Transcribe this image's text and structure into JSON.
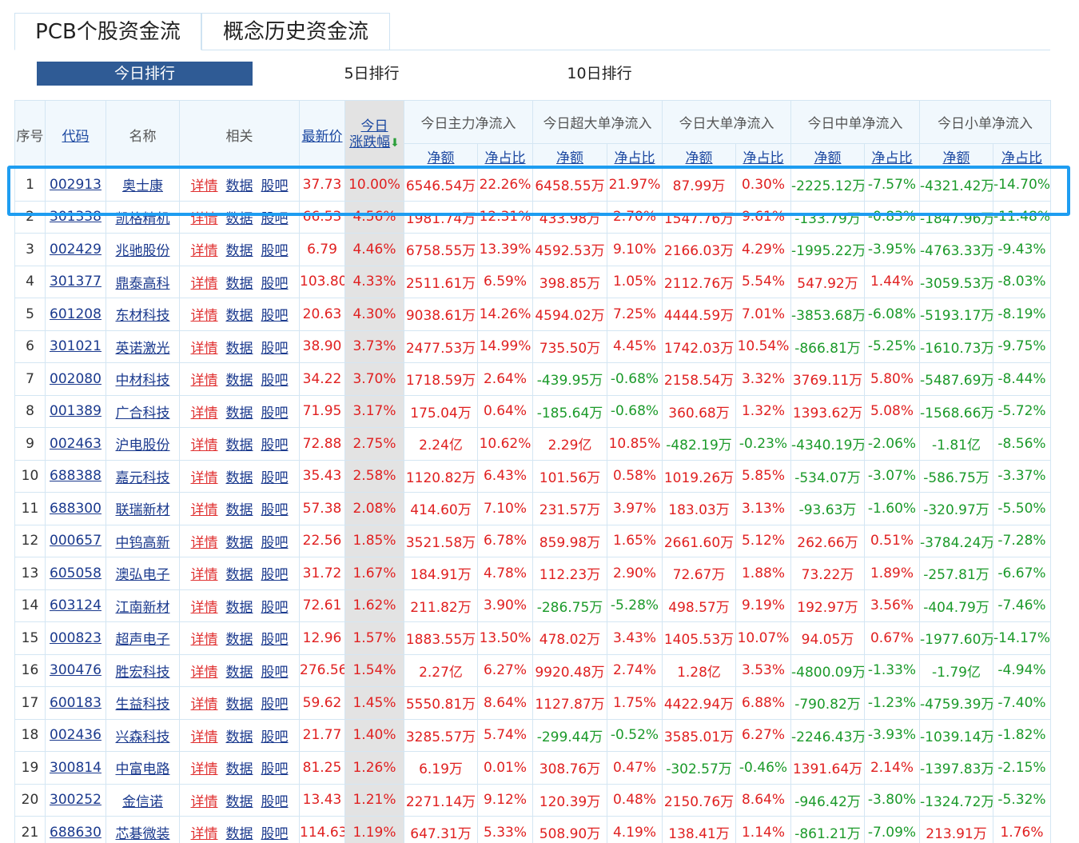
{
  "tabs": [
    {
      "label": "PCB个股资金流",
      "active": true
    },
    {
      "label": "概念历史资金流",
      "active": false
    }
  ],
  "subtabs": [
    {
      "label": "今日排行",
      "active": true
    },
    {
      "label": "5日排行",
      "active": false
    },
    {
      "label": "10日排行",
      "active": false
    }
  ],
  "header": {
    "seq": "序号",
    "code": "代码",
    "name": "名称",
    "related": "相关",
    "price": "最新价",
    "change_line1": "今日",
    "change_line2": "涨跌幅",
    "groups": [
      "今日主力净流入",
      "今日超大单净流入",
      "今日大单净流入",
      "今日中单净流入",
      "今日小单净流入"
    ],
    "net_amount": "净额",
    "net_ratio": "净占比"
  },
  "related_links": [
    "详情",
    "数据",
    "股吧"
  ],
  "colors": {
    "accent": "#2f5b95",
    "up": "#e02020",
    "down": "#1b9a2a",
    "highlight": "#1e9df1"
  },
  "rows": [
    [
      "1",
      "002913",
      "奥士康",
      "37.73",
      "10.00%",
      "6546.54万",
      "22.26%",
      "6458.55万",
      "21.97%",
      "87.99万",
      "0.30%",
      "-2225.12万",
      "-7.57%",
      "-4321.42万",
      "-14.70%"
    ],
    [
      "2",
      "301338",
      "凯格精机",
      "66.53",
      "4.56%",
      "1981.74万",
      "12.31%",
      "433.98万",
      "2.70%",
      "1547.76万",
      "9.61%",
      "-133.79万",
      "-0.83%",
      "-1847.96万",
      "-11.48%"
    ],
    [
      "3",
      "002429",
      "兆驰股份",
      "6.79",
      "4.46%",
      "6758.55万",
      "13.39%",
      "4592.53万",
      "9.10%",
      "2166.03万",
      "4.29%",
      "-1995.22万",
      "-3.95%",
      "-4763.33万",
      "-9.43%"
    ],
    [
      "4",
      "301377",
      "鼎泰高科",
      "103.80",
      "4.33%",
      "2511.61万",
      "6.59%",
      "398.85万",
      "1.05%",
      "2112.76万",
      "5.54%",
      "547.92万",
      "1.44%",
      "-3059.53万",
      "-8.03%"
    ],
    [
      "5",
      "601208",
      "东材科技",
      "20.63",
      "4.30%",
      "9038.61万",
      "14.26%",
      "4594.02万",
      "7.25%",
      "4444.59万",
      "7.01%",
      "-3853.68万",
      "-6.08%",
      "-5193.17万",
      "-8.19%"
    ],
    [
      "6",
      "301021",
      "英诺激光",
      "38.90",
      "3.73%",
      "2477.53万",
      "14.99%",
      "735.50万",
      "4.45%",
      "1742.03万",
      "10.54%",
      "-866.81万",
      "-5.25%",
      "-1610.73万",
      "-9.75%"
    ],
    [
      "7",
      "002080",
      "中材科技",
      "34.22",
      "3.70%",
      "1718.59万",
      "2.64%",
      "-439.95万",
      "-0.68%",
      "2158.54万",
      "3.32%",
      "3769.11万",
      "5.80%",
      "-5487.69万",
      "-8.44%"
    ],
    [
      "8",
      "001389",
      "广合科技",
      "71.95",
      "3.17%",
      "175.04万",
      "0.64%",
      "-185.64万",
      "-0.68%",
      "360.68万",
      "1.32%",
      "1393.62万",
      "5.08%",
      "-1568.66万",
      "-5.72%"
    ],
    [
      "9",
      "002463",
      "沪电股份",
      "72.88",
      "2.75%",
      "2.24亿",
      "10.62%",
      "2.29亿",
      "10.85%",
      "-482.19万",
      "-0.23%",
      "-4340.19万",
      "-2.06%",
      "-1.81亿",
      "-8.56%"
    ],
    [
      "10",
      "688388",
      "嘉元科技",
      "35.43",
      "2.58%",
      "1120.82万",
      "6.43%",
      "101.56万",
      "0.58%",
      "1019.26万",
      "5.85%",
      "-534.07万",
      "-3.07%",
      "-586.75万",
      "-3.37%"
    ],
    [
      "11",
      "688300",
      "联瑞新材",
      "57.38",
      "2.08%",
      "414.60万",
      "7.10%",
      "231.57万",
      "3.97%",
      "183.03万",
      "3.13%",
      "-93.63万",
      "-1.60%",
      "-320.97万",
      "-5.50%"
    ],
    [
      "12",
      "000657",
      "中钨高新",
      "22.56",
      "1.85%",
      "3521.58万",
      "6.78%",
      "859.98万",
      "1.65%",
      "2661.60万",
      "5.12%",
      "262.66万",
      "0.51%",
      "-3784.24万",
      "-7.28%"
    ],
    [
      "13",
      "605058",
      "澳弘电子",
      "31.72",
      "1.67%",
      "184.91万",
      "4.78%",
      "112.23万",
      "2.90%",
      "72.67万",
      "1.88%",
      "73.22万",
      "1.89%",
      "-257.81万",
      "-6.67%"
    ],
    [
      "14",
      "603124",
      "江南新材",
      "72.61",
      "1.62%",
      "211.82万",
      "3.90%",
      "-286.75万",
      "-5.28%",
      "498.57万",
      "9.19%",
      "192.97万",
      "3.56%",
      "-404.79万",
      "-7.46%"
    ],
    [
      "15",
      "000823",
      "超声电子",
      "12.96",
      "1.57%",
      "1883.55万",
      "13.50%",
      "478.02万",
      "3.43%",
      "1405.53万",
      "10.07%",
      "94.05万",
      "0.67%",
      "-1977.60万",
      "-14.17%"
    ],
    [
      "16",
      "300476",
      "胜宏科技",
      "276.56",
      "1.54%",
      "2.27亿",
      "6.27%",
      "9920.48万",
      "2.74%",
      "1.28亿",
      "3.53%",
      "-4800.09万",
      "-1.33%",
      "-1.79亿",
      "-4.94%"
    ],
    [
      "17",
      "600183",
      "生益科技",
      "59.62",
      "1.45%",
      "5550.81万",
      "8.64%",
      "1127.87万",
      "1.75%",
      "4422.94万",
      "6.88%",
      "-790.82万",
      "-1.23%",
      "-4759.39万",
      "-7.40%"
    ],
    [
      "18",
      "002436",
      "兴森科技",
      "21.77",
      "1.40%",
      "3285.57万",
      "5.74%",
      "-299.44万",
      "-0.52%",
      "3585.01万",
      "6.27%",
      "-2246.43万",
      "-3.93%",
      "-1039.14万",
      "-1.82%"
    ],
    [
      "19",
      "300814",
      "中富电路",
      "81.25",
      "1.26%",
      "6.19万",
      "0.01%",
      "308.76万",
      "0.47%",
      "-302.57万",
      "-0.46%",
      "1391.64万",
      "2.14%",
      "-1397.83万",
      "-2.15%"
    ],
    [
      "20",
      "300252",
      "金信诺",
      "13.43",
      "1.21%",
      "2271.14万",
      "9.12%",
      "120.39万",
      "0.48%",
      "2150.76万",
      "8.64%",
      "-946.42万",
      "-3.80%",
      "-1324.72万",
      "-5.32%"
    ],
    [
      "21",
      "688630",
      "芯碁微装",
      "114.63",
      "1.19%",
      "647.31万",
      "5.33%",
      "508.90万",
      "4.19%",
      "138.41万",
      "1.14%",
      "-861.21万",
      "-7.09%",
      "213.91万",
      "1.76%"
    ]
  ]
}
